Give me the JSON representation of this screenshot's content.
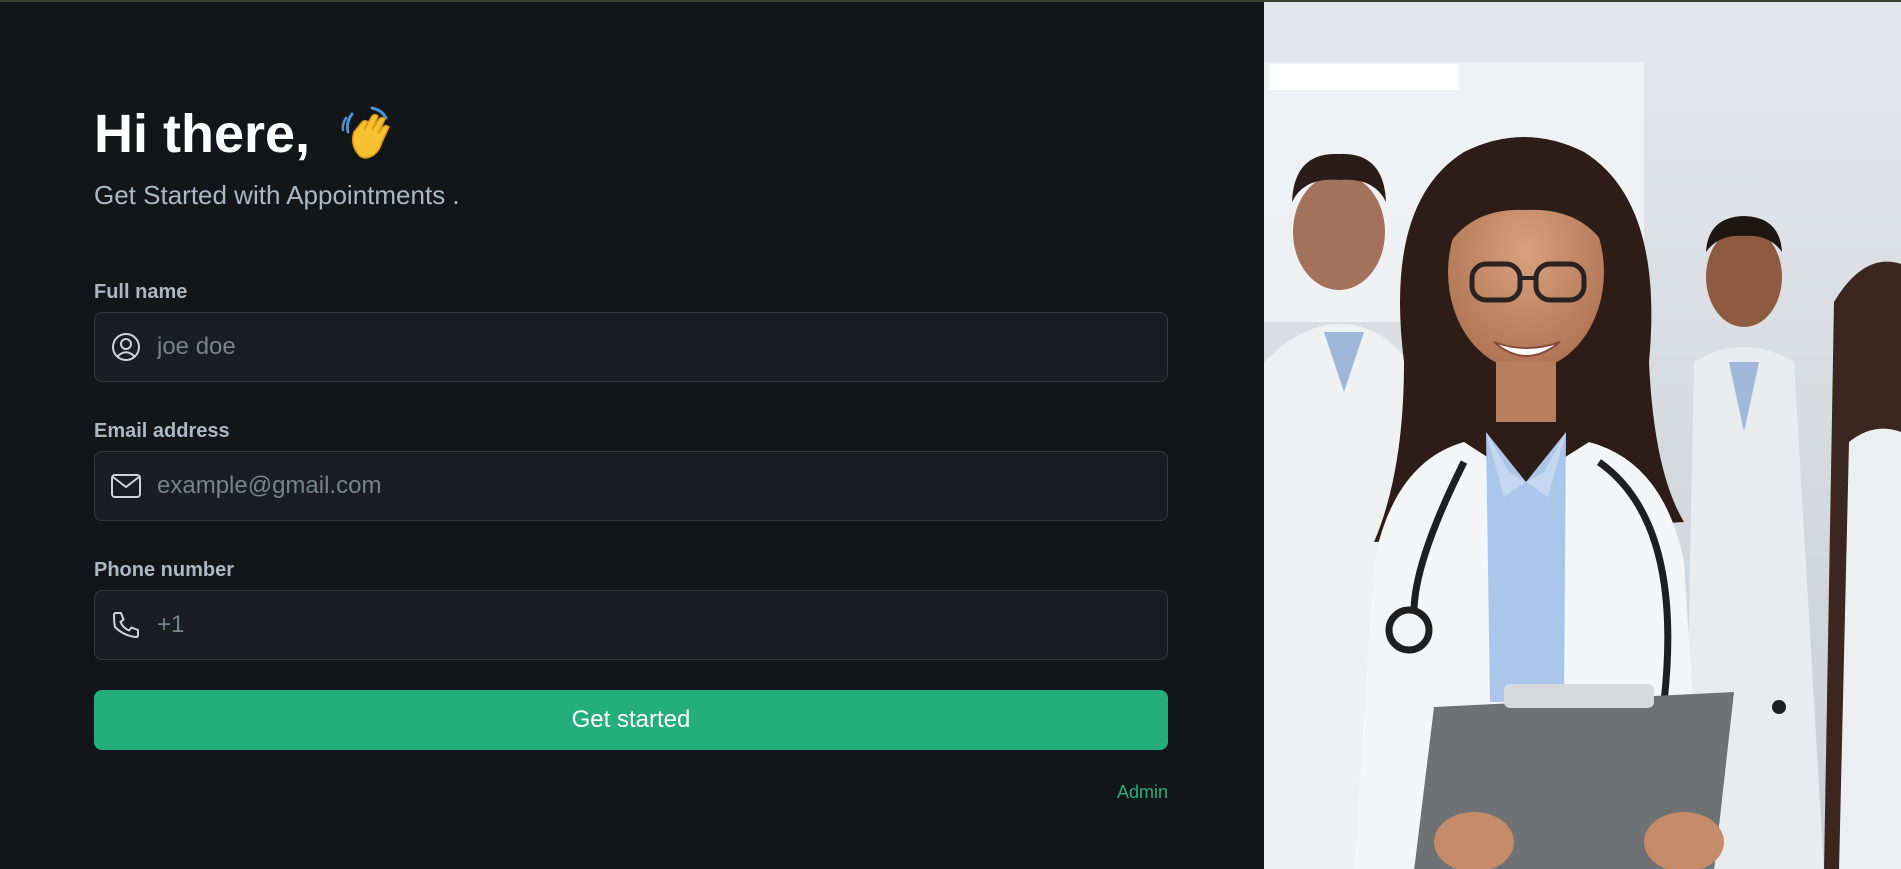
{
  "hero": {
    "title": "Hi there,",
    "subtitle": "Get Started with Appointments ."
  },
  "form": {
    "full_name": {
      "label": "Full name",
      "placeholder": "joe doe",
      "icon": "user-circle-icon"
    },
    "email": {
      "label": "Email address",
      "placeholder": "example@gmail.com",
      "icon": "mail-icon"
    },
    "phone": {
      "label": "Phone number",
      "placeholder": "+1",
      "icon": "phone-icon"
    },
    "submit_label": "Get started"
  },
  "footer": {
    "admin_label": "Admin"
  },
  "colors": {
    "background": "#131619",
    "input_bg": "#1a1d21",
    "accent": "#24ae7c",
    "label": "#abb8c4"
  }
}
